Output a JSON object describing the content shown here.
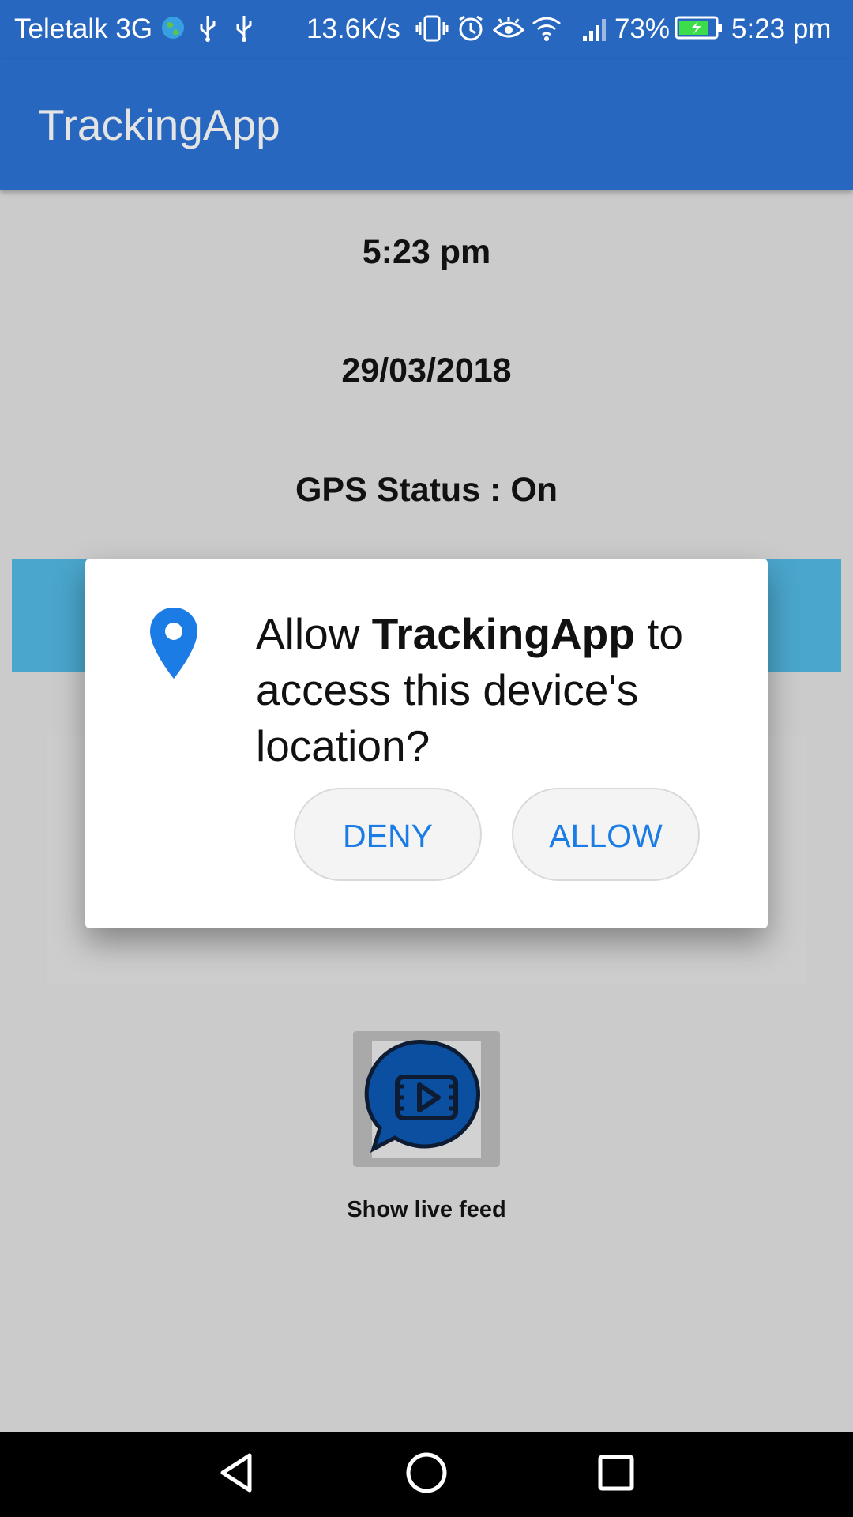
{
  "status_bar": {
    "carrier": "Teletalk 3G",
    "speed": "13.6K/s",
    "battery_percent": "73%",
    "time": "5:23 pm",
    "icons": [
      "globe-icon",
      "usb-icon",
      "usb-icon",
      "vibrate-icon",
      "alarm-icon",
      "eye-icon",
      "wifi-icon",
      "signal-icon",
      "battery-charging-icon"
    ]
  },
  "app_bar": {
    "title": "TrackingApp"
  },
  "main": {
    "time": "5:23 pm",
    "date": "29/03/2018",
    "gps_status": "GPS Status : On",
    "live_feed_label": "Show live feed",
    "live_feed_icon": "video-chat-icon"
  },
  "dialog": {
    "icon": "location-pin-icon",
    "msg_prefix": "Allow ",
    "msg_app": "TrackingApp",
    "msg_suffix": " to access this device's location?",
    "deny_label": "DENY",
    "allow_label": "ALLOW"
  },
  "nav_bar": {
    "icons": [
      "back-icon",
      "home-icon",
      "recents-icon"
    ]
  },
  "colors": {
    "primary": "#2767c0",
    "accent_strip": "#4aa6cc",
    "dialog_button_text": "#1a7ce4",
    "background": "#cbcbcb"
  }
}
